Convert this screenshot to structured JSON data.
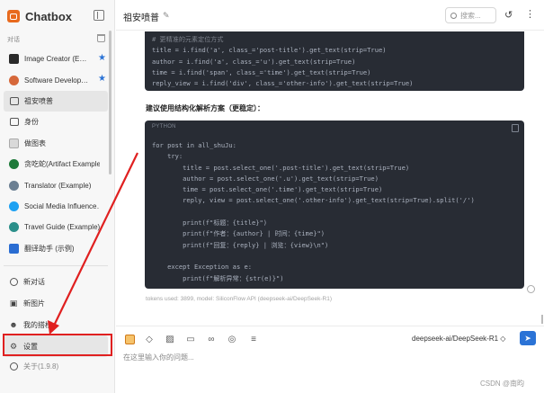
{
  "app": {
    "name": "Chatbox"
  },
  "sidebar": {
    "section_label": "对话",
    "conversations": [
      {
        "label": "Image Creator (E…",
        "icon": "dark-square-avatar",
        "starred": true
      },
      {
        "label": "Software Develop…",
        "icon": "orange-avatar",
        "starred": true
      },
      {
        "label": "祖安喷普",
        "icon": "chat-bubble-icon",
        "starred": false,
        "active": true
      },
      {
        "label": "身份",
        "icon": "chat-bubble-icon",
        "starred": false
      },
      {
        "label": "做图表",
        "icon": "chart-avatar",
        "starred": false
      },
      {
        "label": "贪吃蛇(Artifact Example)",
        "icon": "snake-avatar",
        "starred": false
      },
      {
        "label": "Translator (Example)",
        "icon": "translator-avatar",
        "starred": false
      },
      {
        "label": "Social Media Influence…",
        "icon": "twitter-avatar",
        "starred": false
      },
      {
        "label": "Travel Guide (Example)",
        "icon": "travel-avatar",
        "starred": false
      },
      {
        "label": "翻译助手 (示例)",
        "icon": "language-avatar",
        "starred": false
      }
    ],
    "menu": [
      {
        "label": "新对话",
        "icon": "plus-circle-icon"
      },
      {
        "label": "新图片",
        "icon": "image-icon"
      },
      {
        "label": "我的搭档",
        "icon": "robot-icon"
      },
      {
        "label": "设置",
        "icon": "gear-icon"
      }
    ],
    "about": "关于(1.9.8)"
  },
  "header": {
    "title": "祖安喷普",
    "search_placeholder": "搜索..."
  },
  "message": {
    "code_block_1": [
      "# 更精准的元素定位方式",
      "title = i.find('a', class_='post-title').get_text(strip=True)",
      "author = i.find('a', class_='u').get_text(strip=True)",
      "time = i.find('span', class_='time').get_text(strip=True)",
      "reply_view = i.find('div', class_='other-info').get_text(strip=True)"
    ],
    "suggestion": "建议使用结构化解析方案（更稳定）：",
    "code_block_2_lang": "PYTHON",
    "code_block_2": [
      "for post in all_shuJu:",
      "    try:",
      "        title = post.select_one('.post-title').get_text(strip=True)",
      "        author = post.select_one('.u').get_text(strip=True)",
      "        time = post.select_one('.time').get_text(strip=True)",
      "        reply, view = post.select_one('.other-info').get_text(strip=True).split('/')",
      "",
      "        print(f\"标题：{title}\")",
      "        print(f\"作者：{author} | 时间：{time}\")",
      "        print(f\"回复：{reply} | 浏览：{view}\\n\")",
      "",
      "    except Exception as e:",
      "        print(f\"解析异常：{str(e)}\")"
    ],
    "tokens_info": "tokens used: 3899, model: SiliconFlow API (deepseek-ai/DeepSeek-R1)"
  },
  "composer": {
    "model": "deepseek-ai/DeepSeek-R1 ◇",
    "placeholder": "在这里输入你的问题...",
    "tools": [
      "image-attach-icon",
      "eraser-icon",
      "picture-icon",
      "folder-icon",
      "link-icon",
      "globe-icon",
      "settings-sliders-icon"
    ]
  },
  "watermark": "CSDN @南昀",
  "annotation": {
    "color": "#e02020",
    "target": "settings-menu-item"
  }
}
